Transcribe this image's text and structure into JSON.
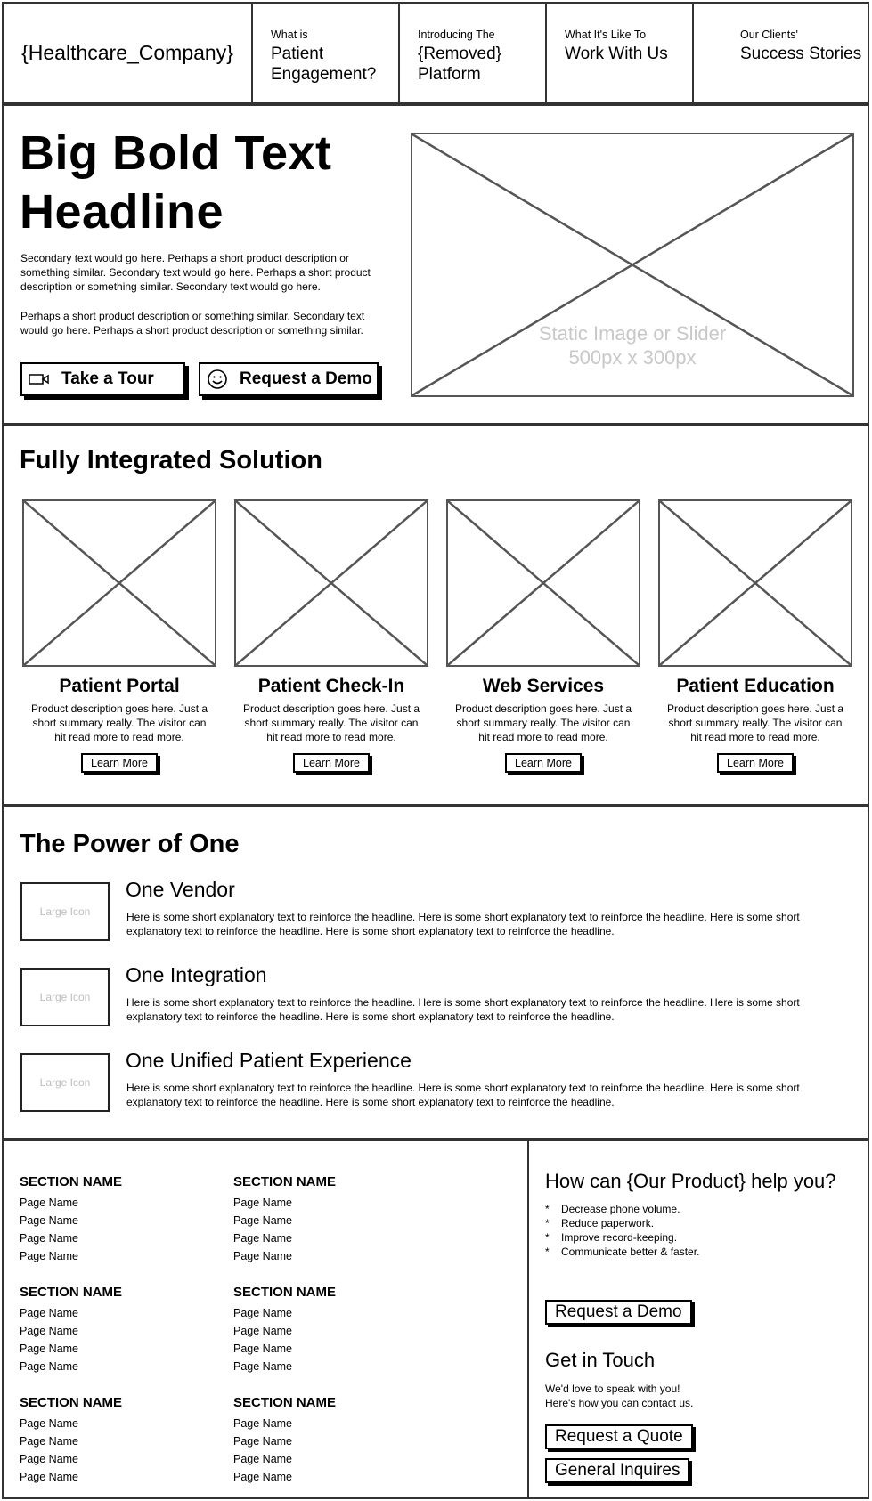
{
  "nav": {
    "logo": "{Healthcare_Company}",
    "items": [
      {
        "small": "What is",
        "big": "Patient Engagement?"
      },
      {
        "small": "Introducing The",
        "big": "{Removed} Platform"
      },
      {
        "small": "What It's Like To",
        "big": "Work With Us"
      },
      {
        "small": "Our Clients'",
        "big": "Success Stories"
      }
    ]
  },
  "hero": {
    "headline": "Big Bold Text Headline",
    "para1": "Secondary text would go here.  Perhaps a short product description or something similar.  Secondary text would go here.  Perhaps a short product description or something similar.  Secondary text would go here.",
    "para2": "Perhaps a short product description or something similar.  Secondary text would go here.  Perhaps a short product description or something similar.",
    "tour_button": "Take a Tour",
    "demo_button": "Request a Demo",
    "image_caption_line1": "Static Image or Slider",
    "image_caption_line2": "500px x 300px",
    "icons": {
      "tour": "video-camera-icon",
      "demo": "smiley-face-icon"
    }
  },
  "solutions": {
    "title": "Fully Integrated Solution",
    "cards": [
      {
        "title": "Patient Portal",
        "desc": "Product description goes here.  Just a short summary really.  The visitor can hit read more to read more.",
        "button": "Learn More"
      },
      {
        "title": "Patient Check-In",
        "desc": "Product description goes here.  Just a short summary really.  The visitor can hit read more to read more.",
        "button": "Learn More"
      },
      {
        "title": "Web Services",
        "desc": "Product description goes here.  Just a short summary really.  The visitor can hit read more to read more.",
        "button": "Learn More"
      },
      {
        "title": "Patient Education",
        "desc": "Product description goes here.  Just a short summary really.  The visitor can hit read more to read more.",
        "button": "Learn More"
      }
    ]
  },
  "power": {
    "title": "The Power of One",
    "icon_label": "Large Icon",
    "rows": [
      {
        "title": "One Vendor",
        "text": "Here is some short explanatory text to reinforce the headline.  Here is some short explanatory text to reinforce the headline.  Here is some short explanatory text to reinforce the headline.  Here is some short explanatory text to reinforce the headline."
      },
      {
        "title": "One Integration",
        "text": "Here is some short explanatory text to reinforce the headline.  Here is some short explanatory text to reinforce the headline.  Here is some short explanatory text to reinforce the headline.  Here is some short explanatory text to reinforce the headline."
      },
      {
        "title": "One Unified Patient Experience",
        "text": "Here is some short explanatory text to reinforce the headline.  Here is some short explanatory text to reinforce the headline.  Here is some short explanatory text to reinforce the headline.  Here is some short explanatory text to reinforce the headline."
      }
    ]
  },
  "footer": {
    "columns": [
      {
        "heading": "SECTION NAME",
        "links": [
          "Page Name",
          "Page Name",
          "Page Name",
          "Page Name"
        ]
      },
      {
        "heading": "SECTION NAME",
        "links": [
          "Page Name",
          "Page Name",
          "Page Name",
          "Page Name"
        ]
      },
      {
        "heading": "SECTION NAME",
        "links": [
          "Page Name",
          "Page Name",
          "Page Name",
          "Page Name"
        ]
      },
      {
        "heading": "SECTION NAME",
        "links": [
          "Page Name",
          "Page Name",
          "Page Name",
          "Page Name"
        ]
      },
      {
        "heading": "SECTION NAME",
        "links": [
          "Page Name",
          "Page Name",
          "Page Name",
          "Page Name"
        ]
      },
      {
        "heading": "SECTION NAME",
        "links": [
          "Page Name",
          "Page Name",
          "Page Name",
          "Page Name"
        ]
      }
    ],
    "help_title": "How can {Our Product} help you?",
    "bullet": "*",
    "benefits": [
      "Decrease phone volume.",
      "Reduce paperwork.",
      "Improve record-keeping.",
      "Communicate better & faster."
    ],
    "demo_button": "Request a Demo",
    "touch_title": "Get in Touch",
    "contact_line1": "We'd love to speak with you!",
    "contact_line2": "Here's how you can contact us.",
    "quote_button": "Request a Quote",
    "inquire_button": "General Inquires"
  }
}
